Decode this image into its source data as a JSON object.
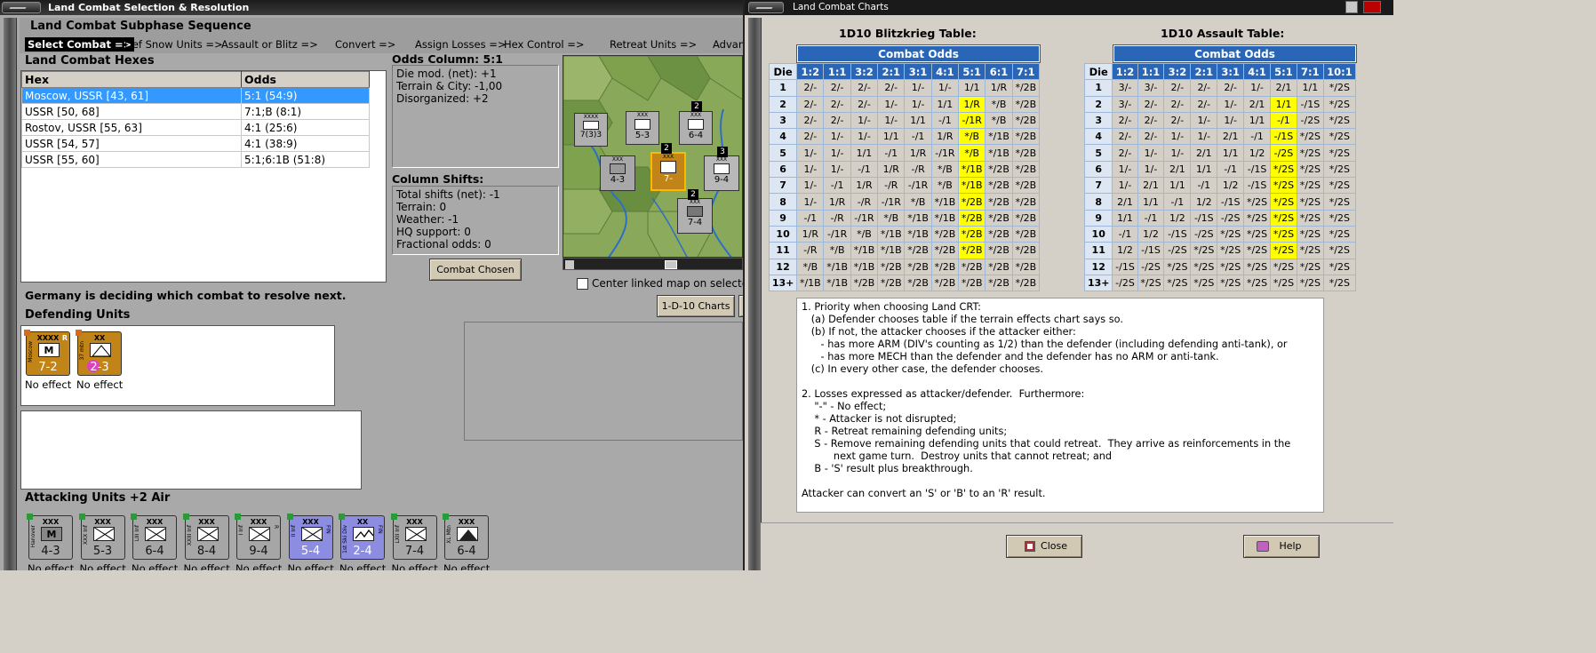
{
  "left_window": {
    "title": "Land Combat Selection & Resolution",
    "subphase": {
      "title": "Land Combat Subphase Sequence",
      "steps": [
        "Select Combat =>",
        "Def Snow Units =>",
        "Assault or Blitz =>",
        "Convert =>",
        "Assign Losses =>",
        "Hex Control =>",
        "Retreat Units =>",
        "Advan"
      ],
      "active_step": "Select Combat =>"
    },
    "hexes": {
      "label": "Land Combat Hexes",
      "columns": [
        "Hex",
        "Odds"
      ],
      "rows": [
        {
          "hex": "Moscow, USSR [43, 61]",
          "odds": "5:1 (54:9)"
        },
        {
          "hex": "USSR [50, 68]",
          "odds": "7:1;B (8:1)"
        },
        {
          "hex": "Rostov, USSR [55, 63]",
          "odds": "4:1 (25:6)"
        },
        {
          "hex": "USSR [54, 57]",
          "odds": "4:1 (38:9)"
        },
        {
          "hex": "USSR [55, 60]",
          "odds": "5:1;6:1B (51:8)"
        }
      ],
      "selected_row": 0
    },
    "odds_column": {
      "title": "Odds Column: 5:1",
      "lines": [
        "Die mod. (net): +1",
        "Terrain & City: -1,00",
        "Disorganized: +2"
      ]
    },
    "column_shifts": {
      "title": "Column Shifts:",
      "lines": [
        "Total shifts (net): -1",
        "Terrain: 0",
        "Weather: -1",
        "HQ support: 0",
        "Fractional odds: 0"
      ]
    },
    "combat_chosen_button": "Combat Chosen",
    "center_linked_map_label": "Center linked map on selecte",
    "charts_button": "1-D-10 Charts",
    "status_message": "Germany is deciding which combat to resolve next.",
    "defending_label": "Defending Units",
    "defending_units": [
      {
        "size": "XXXX",
        "side_label": "Moscow",
        "corner": "R",
        "strength": "7-2",
        "result": "No effect",
        "type": "mech"
      },
      {
        "size": "XX",
        "side_label": "37 mtn",
        "corner": "",
        "strength": "2-3",
        "result": "No effect",
        "type": "mountain"
      }
    ],
    "attacking_label": "Attacking Units +2 Air",
    "attacking_units": [
      {
        "size": "XXX",
        "side_label": "Hanover",
        "strength": "4-3",
        "result": "No effect",
        "type": "mech",
        "color": "grey",
        "corner": ""
      },
      {
        "size": "XXX",
        "side_label": "XXX Inf",
        "strength": "5-3",
        "result": "No effect",
        "type": "inf",
        "color": "grey",
        "corner": ""
      },
      {
        "size": "XXX",
        "side_label": "LIII Inf",
        "strength": "6-4",
        "result": "No effect",
        "type": "inf",
        "color": "grey",
        "corner": ""
      },
      {
        "size": "XXX",
        "side_label": "XXIII Inf",
        "strength": "8-4",
        "result": "No effect",
        "type": "inf",
        "color": "grey",
        "corner": ""
      },
      {
        "size": "XXX",
        "side_label": "I Inf",
        "strength": "9-4",
        "result": "No effect",
        "type": "inf",
        "color": "grey",
        "corner": "R"
      },
      {
        "size": "XXX",
        "side_label": "II Inf",
        "strength": "5-4",
        "result": "No effect",
        "type": "inf",
        "color": "blue",
        "corner": "FIN"
      },
      {
        "size": "XX",
        "side_label": "1st Ski Div",
        "strength": "2-4",
        "result": "No effect",
        "type": "ski",
        "color": "blue",
        "corner": "FIN"
      },
      {
        "size": "XXX",
        "side_label": "LXII Inf",
        "strength": "7-4",
        "result": "No effect",
        "type": "inf",
        "color": "grey",
        "corner": ""
      },
      {
        "size": "XXX",
        "side_label": "XL Mtn",
        "strength": "6-4",
        "result": "No effect",
        "type": "mountain",
        "color": "grey",
        "corner": ""
      }
    ],
    "map_counters": [
      {
        "size": "XXXX",
        "strength": "7(3)3"
      },
      {
        "size": "XXX",
        "strength": "5-3"
      },
      {
        "size": "XXX",
        "strength": "6-4"
      },
      {
        "size": "XXX",
        "strength": "4-3"
      },
      {
        "size": "XXX",
        "strength": "7-"
      },
      {
        "size": "XXX",
        "strength": "9-4"
      },
      {
        "size": "XXX",
        "strength": "7-4"
      }
    ],
    "map_stack_numbers": [
      "2",
      "3",
      "2",
      "2"
    ]
  },
  "right_window": {
    "title": "Land Combat Charts",
    "combat_odds_label": "Combat Odds",
    "die_label": "Die",
    "blitz": {
      "title": "1D10 Blitzkrieg Table:",
      "odds": [
        "1:2",
        "1:1",
        "3:2",
        "2:1",
        "3:1",
        "4:1",
        "5:1",
        "6:1",
        "7:1"
      ],
      "rows": [
        {
          "die": "1",
          "cells": [
            "2/-",
            "2/-",
            "2/-",
            "2/-",
            "1/-",
            "1/-",
            "1/1",
            "1/R",
            "*/2B"
          ]
        },
        {
          "die": "2",
          "cells": [
            "2/-",
            "2/-",
            "2/-",
            "1/-",
            "1/-",
            "1/1",
            "1/R",
            "*/B",
            "*/2B"
          ]
        },
        {
          "die": "3",
          "cells": [
            "2/-",
            "2/-",
            "1/-",
            "1/-",
            "1/1",
            "-/1",
            "-/1R",
            "*/B",
            "*/2B"
          ]
        },
        {
          "die": "4",
          "cells": [
            "2/-",
            "1/-",
            "1/-",
            "1/1",
            "-/1",
            "1/R",
            "*/B",
            "*/1B",
            "*/2B"
          ]
        },
        {
          "die": "5",
          "cells": [
            "1/-",
            "1/-",
            "1/1",
            "-/1",
            "1/R",
            "-/1R",
            "*/B",
            "*/1B",
            "*/2B"
          ]
        },
        {
          "die": "6",
          "cells": [
            "1/-",
            "1/-",
            "-/1",
            "1/R",
            "-/R",
            "*/B",
            "*/1B",
            "*/2B",
            "*/2B"
          ]
        },
        {
          "die": "7",
          "cells": [
            "1/-",
            "-/1",
            "1/R",
            "-/R",
            "-/1R",
            "*/B",
            "*/1B",
            "*/2B",
            "*/2B"
          ]
        },
        {
          "die": "8",
          "cells": [
            "1/-",
            "1/R",
            "-/R",
            "-/1R",
            "*/B",
            "*/1B",
            "*/2B",
            "*/2B",
            "*/2B"
          ]
        },
        {
          "die": "9",
          "cells": [
            "-/1",
            "-/R",
            "-/1R",
            "*/B",
            "*/1B",
            "*/1B",
            "*/2B",
            "*/2B",
            "*/2B"
          ]
        },
        {
          "die": "10",
          "cells": [
            "1/R",
            "-/1R",
            "*/B",
            "*/1B",
            "*/1B",
            "*/2B",
            "*/2B",
            "*/2B",
            "*/2B"
          ]
        },
        {
          "die": "11",
          "cells": [
            "-/R",
            "*/B",
            "*/1B",
            "*/1B",
            "*/2B",
            "*/2B",
            "*/2B",
            "*/2B",
            "*/2B"
          ]
        },
        {
          "die": "12",
          "cells": [
            "*/B",
            "*/1B",
            "*/1B",
            "*/2B",
            "*/2B",
            "*/2B",
            "*/2B",
            "*/2B",
            "*/2B"
          ]
        },
        {
          "die": "13+",
          "cells": [
            "*/1B",
            "*/1B",
            "*/2B",
            "*/2B",
            "*/2B",
            "*/2B",
            "*/2B",
            "*/2B",
            "*/2B"
          ]
        }
      ]
    },
    "assault": {
      "title": "1D10 Assault Table:",
      "odds": [
        "1:2",
        "1:1",
        "3:2",
        "2:1",
        "3:1",
        "4:1",
        "5:1",
        "7:1",
        "10:1"
      ],
      "rows": [
        {
          "die": "1",
          "cells": [
            "3/-",
            "3/-",
            "2/-",
            "2/-",
            "2/-",
            "1/-",
            "2/1",
            "1/1",
            "*/2S"
          ]
        },
        {
          "die": "2",
          "cells": [
            "3/-",
            "2/-",
            "2/-",
            "2/-",
            "1/-",
            "2/1",
            "1/1",
            "-/1S",
            "*/2S"
          ]
        },
        {
          "die": "3",
          "cells": [
            "2/-",
            "2/-",
            "2/-",
            "1/-",
            "1/-",
            "1/1",
            "-/1",
            "-/2S",
            "*/2S"
          ]
        },
        {
          "die": "4",
          "cells": [
            "2/-",
            "2/-",
            "1/-",
            "1/-",
            "2/1",
            "-/1",
            "-/1S",
            "*/2S",
            "*/2S"
          ]
        },
        {
          "die": "5",
          "cells": [
            "2/-",
            "1/-",
            "1/-",
            "2/1",
            "1/1",
            "1/2",
            "-/2S",
            "*/2S",
            "*/2S"
          ]
        },
        {
          "die": "6",
          "cells": [
            "1/-",
            "1/-",
            "2/1",
            "1/1",
            "-/1",
            "-/1S",
            "*/2S",
            "*/2S",
            "*/2S"
          ]
        },
        {
          "die": "7",
          "cells": [
            "1/-",
            "2/1",
            "1/1",
            "-/1",
            "1/2",
            "-/1S",
            "*/2S",
            "*/2S",
            "*/2S"
          ]
        },
        {
          "die": "8",
          "cells": [
            "2/1",
            "1/1",
            "-/1",
            "1/2",
            "-/1S",
            "*/2S",
            "*/2S",
            "*/2S",
            "*/2S"
          ]
        },
        {
          "die": "9",
          "cells": [
            "1/1",
            "-/1",
            "1/2",
            "-/1S",
            "-/2S",
            "*/2S",
            "*/2S",
            "*/2S",
            "*/2S"
          ]
        },
        {
          "die": "10",
          "cells": [
            "-/1",
            "1/2",
            "-/1S",
            "-/2S",
            "*/2S",
            "*/2S",
            "*/2S",
            "*/2S",
            "*/2S"
          ]
        },
        {
          "die": "11",
          "cells": [
            "1/2",
            "-/1S",
            "-/2S",
            "*/2S",
            "*/2S",
            "*/2S",
            "*/2S",
            "*/2S",
            "*/2S"
          ]
        },
        {
          "die": "12",
          "cells": [
            "-/1S",
            "-/2S",
            "*/2S",
            "*/2S",
            "*/2S",
            "*/2S",
            "*/2S",
            "*/2S",
            "*/2S"
          ]
        },
        {
          "die": "13+",
          "cells": [
            "-/2S",
            "*/2S",
            "*/2S",
            "*/2S",
            "*/2S",
            "*/2S",
            "*/2S",
            "*/2S",
            "*/2S"
          ]
        }
      ]
    },
    "highlight_color": "#ffff00",
    "header_color": "#2a66b8",
    "notes": [
      "1. Priority when choosing Land CRT:",
      "   (a) Defender chooses table if the terrain effects chart says so.",
      "   (b) If not, the attacker chooses if the attacker either:",
      "      - has more ARM (DIV's counting as 1/2) than the defender (including defending anti-tank), or",
      "      - has more MECH than the defender and the defender has no ARM or anti-tank.",
      "   (c) In every other case, the defender chooses.",
      "",
      "2. Losses expressed as attacker/defender.  Furthermore:",
      "    \"-\" - No effect;",
      "    * - Attacker is not disrupted;",
      "    R - Retreat remaining defending units;",
      "    S - Remove remaining defending units that could retreat.  They arrive as reinforcements in the",
      "          next game turn.  Destroy units that cannot retreat; and",
      "    B - 'S' result plus breakthrough.",
      "",
      "Attacker can convert an 'S' or 'B' to an 'R' result."
    ],
    "close_button": "Close",
    "help_button": "Help"
  }
}
